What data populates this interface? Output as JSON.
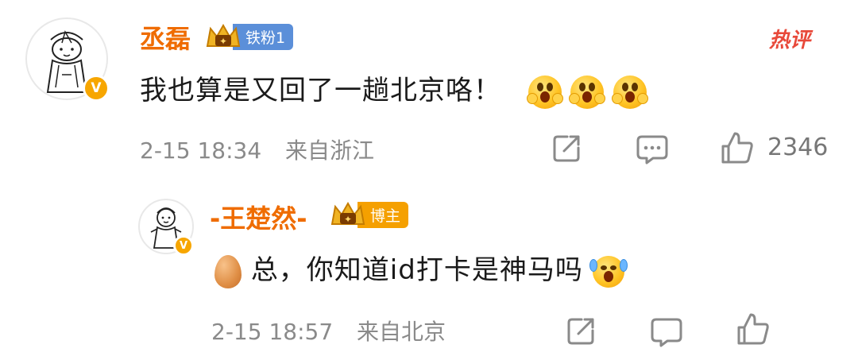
{
  "comment1": {
    "username": "丞磊",
    "fan_badge": "铁粉1",
    "hot_label": "热评",
    "text": "我也算是又回了一趟北京咯！",
    "emoji_count": 3,
    "timestamp": "2-15 18:34",
    "location": "来自浙江",
    "like_count": "2346",
    "verified_badge": "V"
  },
  "reply1": {
    "username": "-王楚然-",
    "role_badge": "博主",
    "text_prefix_icon": "egg-emoji",
    "text": "总，你知道id打卡是神马吗",
    "timestamp": "2-15 18:57",
    "location": "来自北京",
    "verified_badge": "V"
  },
  "colors": {
    "username": "#ef6c00",
    "hot": "#e8493a",
    "meta": "#8a8a8a",
    "verified": "#f7a600"
  }
}
